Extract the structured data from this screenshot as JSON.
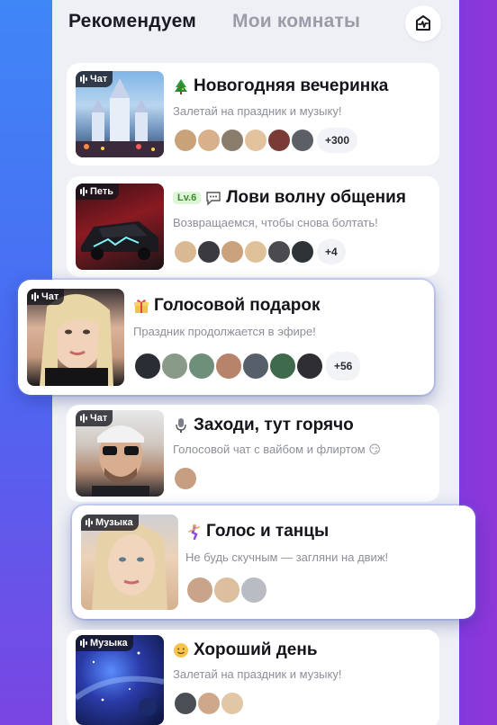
{
  "tabs": {
    "recommended": "Рекомендуем",
    "my_rooms": "Мои комнаты"
  },
  "rooms": [
    {
      "badge": "Чат",
      "icon": "christmas-tree-icon",
      "title": "Новогодняя вечеринка",
      "subtitle": "Залетай на праздник и музыку!",
      "count": "+300",
      "avatar_colors": [
        "#c9a27a",
        "#d8b18c",
        "#8a7d6b",
        "#e2c39d",
        "#7a3b36",
        "#5b6067"
      ]
    },
    {
      "badge": "Петь",
      "level": "Lv.6",
      "icon": "speech-bubble-icon",
      "title": "Лови волну общения",
      "subtitle": "Возвращаемся, чтобы снова болтать!",
      "count": "+4",
      "avatar_colors": [
        "#d9b993",
        "#3a3a3f",
        "#caa27d",
        "#e0c29a",
        "#4b4a4f",
        "#2f3236"
      ]
    },
    {
      "badge": "Чат",
      "icon": "gift-icon",
      "title": "Голосовой подарок",
      "subtitle": "Праздник продолжается в эфире!",
      "count": "+56",
      "avatar_colors": [
        "#2a2d33",
        "#8a9a88",
        "#6e8f7a",
        "#b8836b",
        "#57606a",
        "#3f6b4c",
        "#2f2f33"
      ]
    },
    {
      "badge": "Чат",
      "icon": "microphone-icon",
      "title": "Заходи, тут горячо",
      "subtitle": "Голосовой чат с вайбом и флиртом 😏",
      "avatar_colors": [
        "#c89e82"
      ]
    },
    {
      "badge": "Музыка",
      "icon": "dancer-icon",
      "title": "Голос и танцы",
      "subtitle": "Не будь скучным — загляни на движ!",
      "avatar_colors": [
        "#c9a38a",
        "#dcbf9e",
        "#b9bcc2"
      ]
    },
    {
      "badge": "Музыка",
      "icon": "smile-icon",
      "title": "Хороший день",
      "subtitle": "Залетай на праздник и музыку!",
      "avatar_colors": [
        "#4a4f55",
        "#cda88a",
        "#e1c7a6"
      ]
    }
  ],
  "colors": {
    "accent": "#4a5ff0",
    "panel": "#eef0f6"
  }
}
